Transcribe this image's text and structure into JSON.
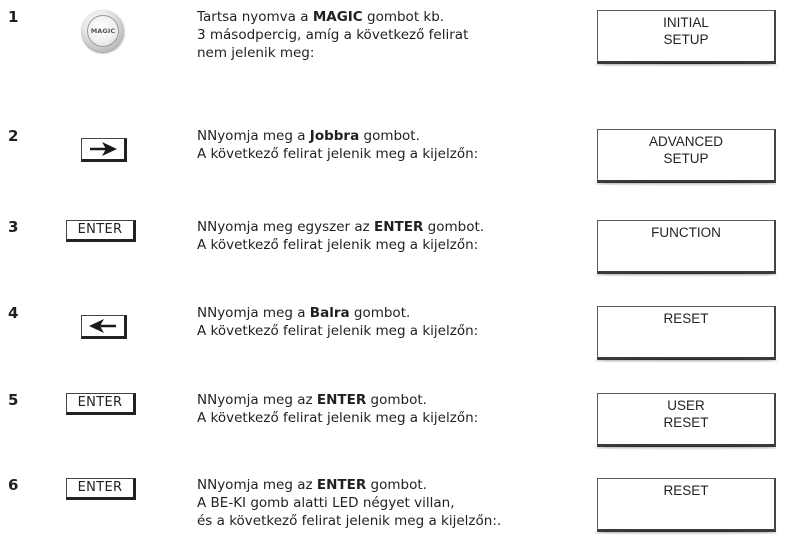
{
  "steps": [
    {
      "number": "1",
      "button": {
        "type": "magic",
        "label": "MAGIC"
      },
      "lines": [
        {
          "pre": "Tartsa nyomva a ",
          "bold": "MAGIC",
          "post": " gombot kb."
        },
        {
          "pre": "3 másodpercig, amíg a következő felirat",
          "bold": "",
          "post": ""
        },
        {
          "pre": "nem jelenik meg:",
          "bold": "",
          "post": ""
        }
      ],
      "display": [
        "INITIAL",
        "SETUP"
      ]
    },
    {
      "number": "2",
      "button": {
        "type": "arrow-right",
        "label": ""
      },
      "lines": [
        {
          "pre": "NNyomja meg a ",
          "bold": "Jobbra",
          "post": " gombot."
        },
        {
          "pre": "A következő felirat jelenik meg a kijelzőn:",
          "bold": "",
          "post": ""
        }
      ],
      "display": [
        "ADVANCED",
        "SETUP"
      ]
    },
    {
      "number": "3",
      "button": {
        "type": "enter",
        "label": "ENTER"
      },
      "lines": [
        {
          "pre": "NNyomja meg egyszer az ",
          "bold": "ENTER",
          "post": " gombot."
        },
        {
          "pre": "A következő felirat jelenik meg a kijelzőn:",
          "bold": "",
          "post": ""
        }
      ],
      "display": [
        "FUNCTION"
      ]
    },
    {
      "number": "4",
      "button": {
        "type": "arrow-left",
        "label": ""
      },
      "lines": [
        {
          "pre": "NNyomja meg a ",
          "bold": "Balra",
          "post": " gombot."
        },
        {
          "pre": "A következő felirat jelenik meg a kijelzőn:",
          "bold": "",
          "post": ""
        }
      ],
      "display": [
        "RESET"
      ]
    },
    {
      "number": "5",
      "button": {
        "type": "enter",
        "label": "ENTER"
      },
      "lines": [
        {
          "pre": "NNyomja meg az ",
          "bold": "ENTER",
          "post": " gombot."
        },
        {
          "pre": "A következő felirat jelenik meg a kijelzőn:",
          "bold": "",
          "post": ""
        }
      ],
      "display": [
        "USER",
        "RESET"
      ]
    },
    {
      "number": "6",
      "button": {
        "type": "enter",
        "label": "ENTER"
      },
      "lines": [
        {
          "pre": "NNyomja meg az ",
          "bold": "ENTER",
          "post": " gombot."
        },
        {
          "pre": "A BE-KI gomb alatti LED négyet villan,",
          "bold": "",
          "post": ""
        },
        {
          "pre": "és a következő felirat jelenik meg a kijelzőn:.",
          "bold": "",
          "post": ""
        }
      ],
      "display": [
        "RESET"
      ]
    }
  ]
}
